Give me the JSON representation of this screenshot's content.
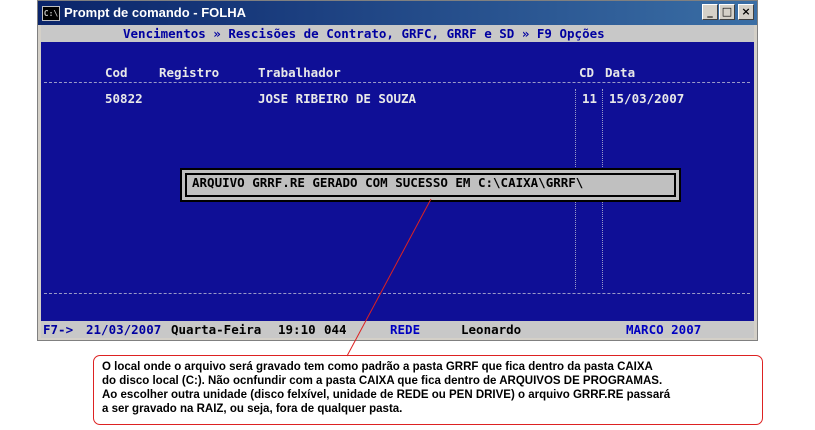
{
  "window": {
    "title": "Prompt de comando - FOLHA",
    "icon": "console-icon",
    "controls": {
      "minimize": "_",
      "maximize": "□",
      "close": "×"
    }
  },
  "console": {
    "breadcrumb": "Vencimentos » Rescisões de Contrato, GRFC, GRRF e SD » F9 Opções",
    "columns": [
      "Cod",
      "Registro",
      "Trabalhador",
      "CD",
      "Data"
    ],
    "rows": [
      {
        "cod": "50822",
        "registro": "",
        "trabalhador": "JOSE RIBEIRO DE SOUZA",
        "cd": "11",
        "data": "15/03/2007"
      }
    ],
    "message": "ARQUIVO GRRF.RE GERADO COM SUCESSO EM C:\\CAIXA\\GRRF\\",
    "status": {
      "key": "F7->",
      "date": "21/03/2007",
      "weekday": "Quarta-Feira",
      "time": "19:10",
      "code": "044",
      "network": "REDE",
      "user": "Leonardo",
      "period": "MARCO 2007"
    }
  },
  "annotation": {
    "lines": [
      "O local onde o arquivo será gravado tem como padrão a pasta GRRF que fica dentro da pasta CAIXA",
      "do disco local (C:). Não ocnfundir com a pasta CAIXA que fica dentro de ARQUIVOS DE PROGRAMAS.",
      "Ao escolher outra unidade (disco felxível, unidade de REDE ou PEN DRIVE) o arquivo GRRF.RE passará",
      "a ser gravado na RAIZ, ou seja, fora de qualquer pasta."
    ],
    "border_color": "#dd2222"
  }
}
